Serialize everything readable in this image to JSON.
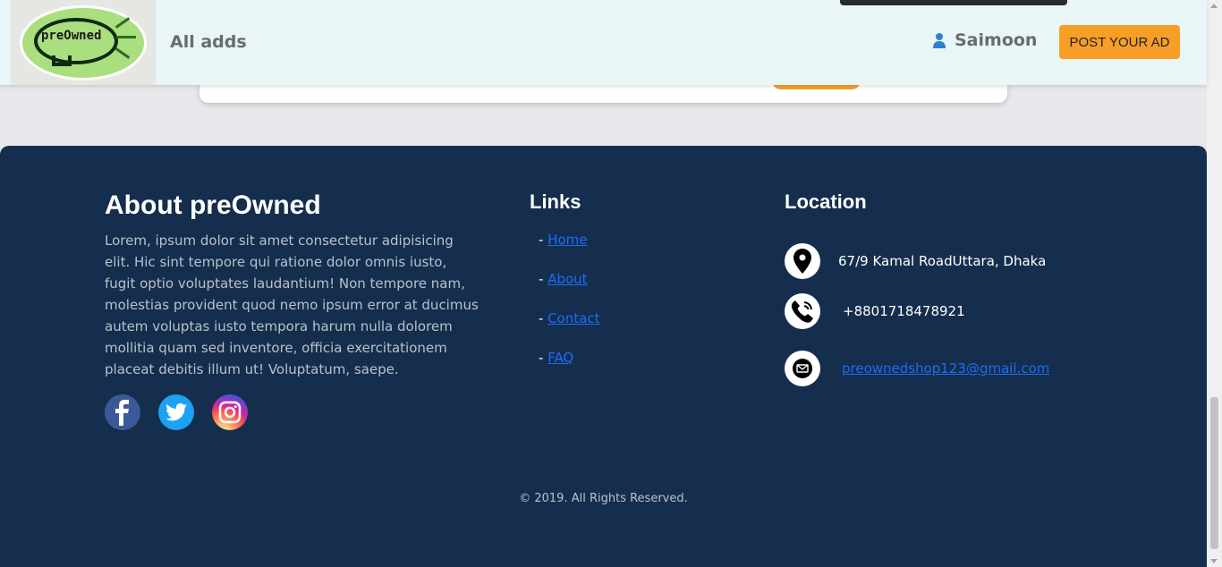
{
  "header": {
    "logo_text": "preOwned",
    "nav_label": "All adds",
    "user_name": "Saimoon",
    "post_button": "POST YOUR AD"
  },
  "footer": {
    "about": {
      "title": "About preOwned",
      "text": "Lorem, ipsum dolor sit amet consectetur adipisicing elit. Hic sint tempore qui ratione dolor omnis iusto, fugit optio voluptates laudantium! Non tempore nam, molestias provident quod nemo ipsum error at ducimus autem voluptas iusto tempora harum nulla dolorem mollitia quam sed inventore, officia exercitationem placeat debitis illum ut! Voluptatum, saepe."
    },
    "social": [
      "facebook-icon",
      "twitter-icon",
      "instagram-icon"
    ],
    "links": {
      "title": "Links",
      "items": [
        "Home",
        "About",
        "Contact",
        "FAQ"
      ]
    },
    "location": {
      "title": "Location",
      "address": "67/9 Kamal RoadUttara, Dhaka",
      "phone": "+8801718478921",
      "email": "preownedshop123@gmail.com"
    },
    "copyright": "© 2019. All Rights Reserved."
  },
  "colors": {
    "header_bg": "#e9f5f7",
    "footer_bg": "#152e4d",
    "accent": "#f79e27",
    "link": "#1e6cf5"
  }
}
